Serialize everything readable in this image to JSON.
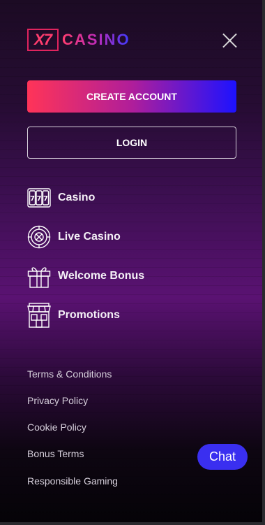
{
  "logo": {
    "mark": "X7",
    "word": "CASINO"
  },
  "buttons": {
    "create_account": "CREATE ACCOUNT",
    "login": "LOGIN"
  },
  "nav": [
    {
      "label": "Casino",
      "icon": "slot-machine-icon"
    },
    {
      "label": "Live Casino",
      "icon": "roulette-icon"
    },
    {
      "label": "Welcome Bonus",
      "icon": "gift-icon"
    },
    {
      "label": "Promotions",
      "icon": "storefront-icon"
    }
  ],
  "footer": [
    "Terms & Conditions",
    "Privacy Policy",
    "Cookie Policy",
    "Bonus Terms",
    "Responsible Gaming"
  ],
  "chat": {
    "label": "Chat"
  },
  "colors": {
    "brand_pink": "#ff3458",
    "brand_blue": "#1d12ff",
    "chat_blue": "#3a2ff0"
  }
}
